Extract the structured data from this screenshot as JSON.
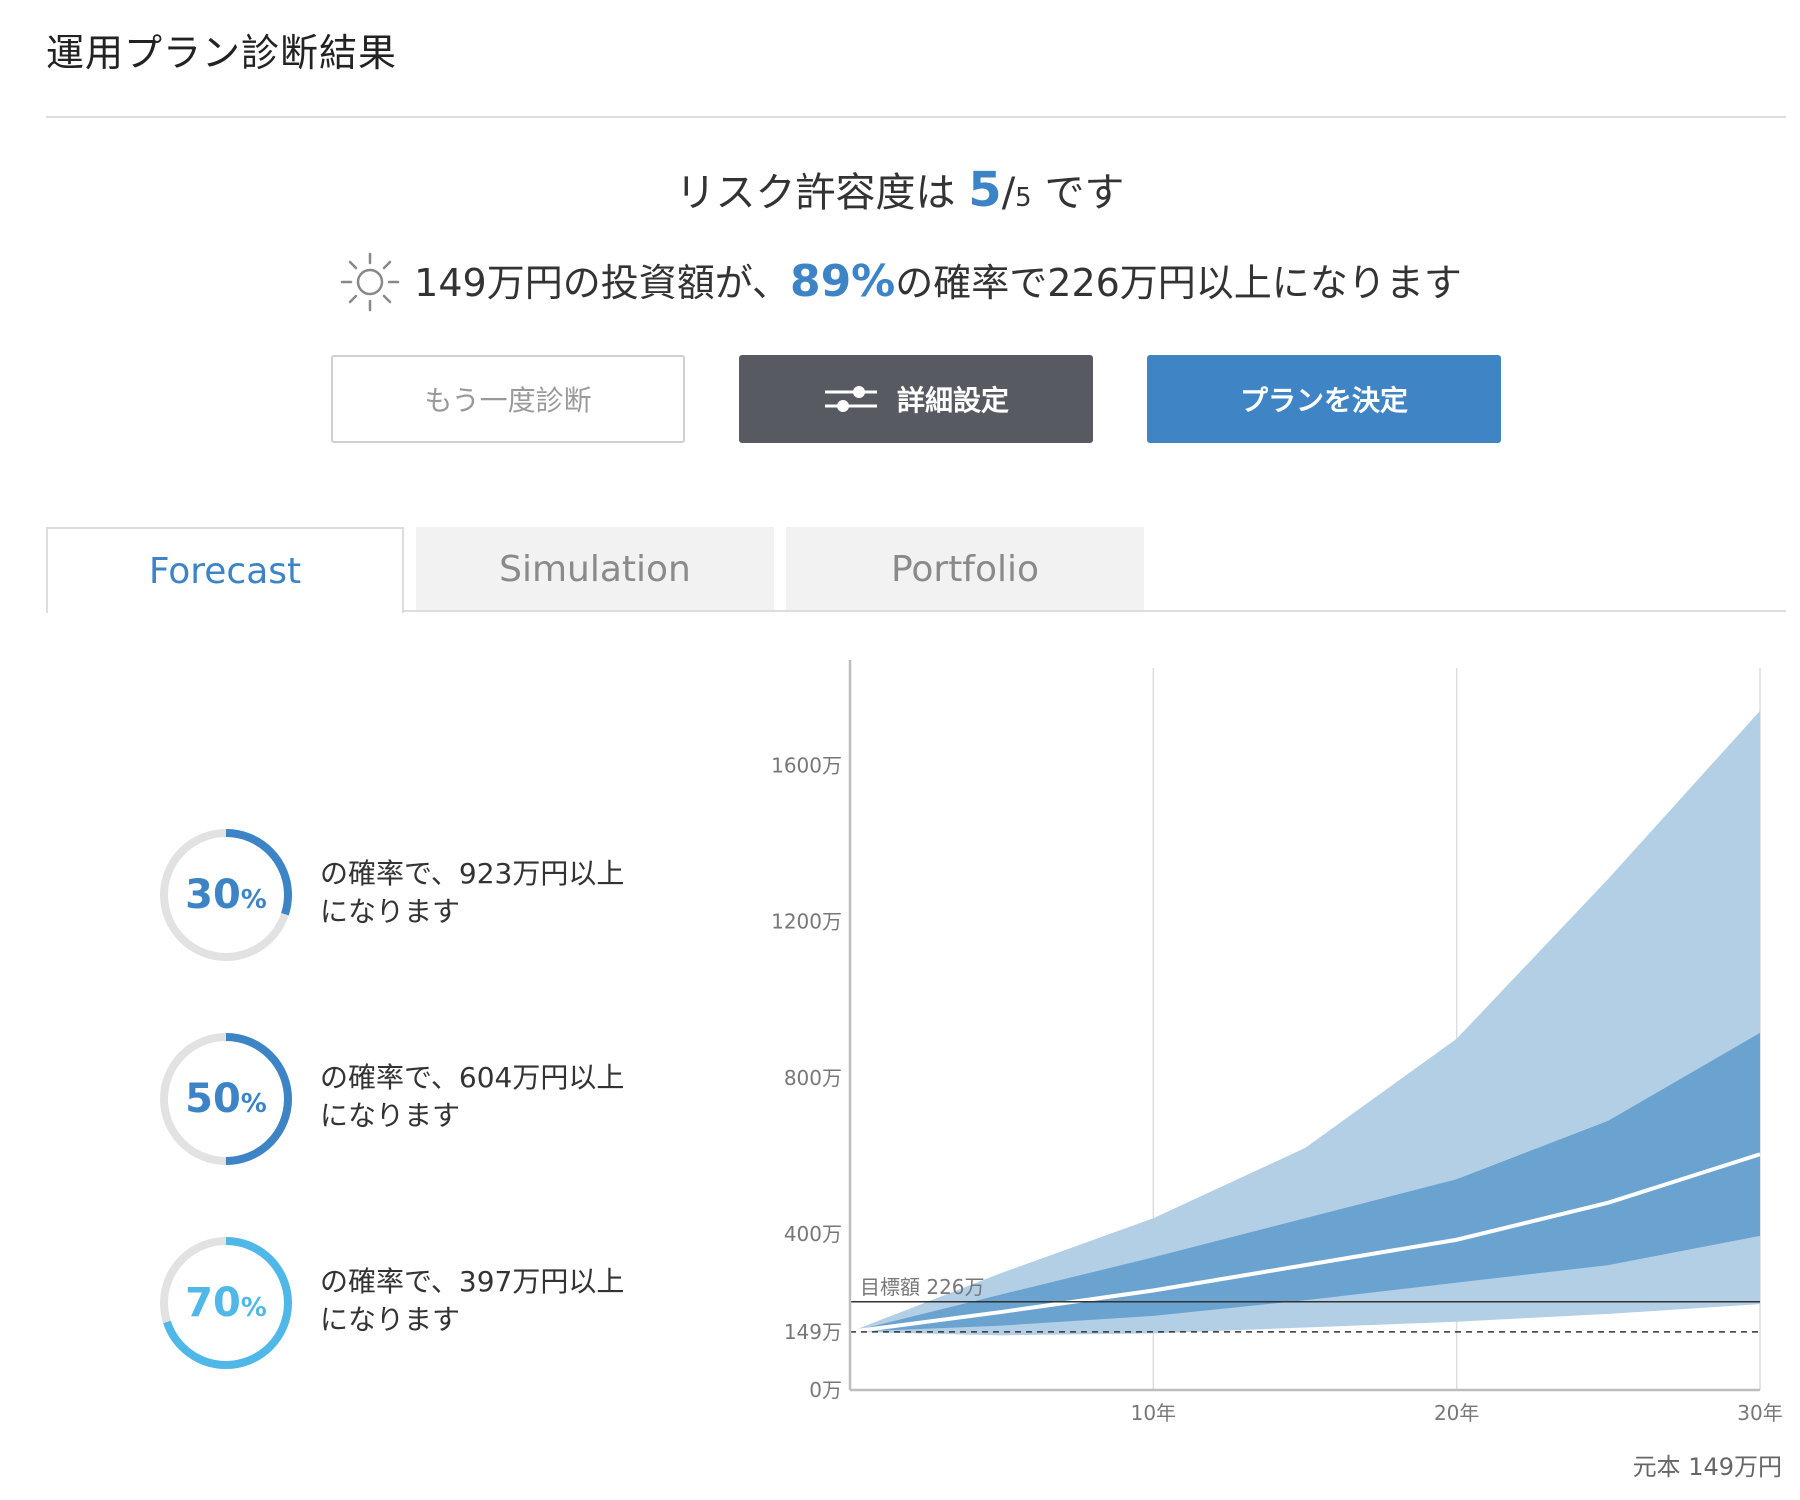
{
  "page_title": "運用プラン診断結果",
  "risk": {
    "prefix": "リスク許容度は",
    "value": "5",
    "slash": "/",
    "max": "5",
    "suffix": "です"
  },
  "probability_summary": {
    "icon": "sun-icon",
    "prefix": "149万円の投資額が、",
    "percent": "89%",
    "suffix": "の確率で226万円以上になります"
  },
  "buttons": {
    "retry": "もう一度診断",
    "detail": "詳細設定",
    "decide": "プランを決定"
  },
  "tabs": [
    "Forecast",
    "Simulation",
    "Portfolio"
  ],
  "active_tab": "Forecast",
  "forecasts": [
    {
      "value": "30",
      "unit": "%",
      "line1": "の確率で、923万円以上",
      "line2": "になります",
      "fraction": 0.3,
      "color": "#3d84c6"
    },
    {
      "value": "50",
      "unit": "%",
      "line1": "の確率で、604万円以上",
      "line2": "になります",
      "fraction": 0.5,
      "color": "#3d84c6"
    },
    {
      "value": "70",
      "unit": "%",
      "line1": "の確率で、397万円以上",
      "line2": "になります",
      "fraction": 0.7,
      "color": "#4fb8e8"
    }
  ],
  "principal_note": "元本 149万円",
  "chart_data": {
    "type": "area",
    "x": [
      0,
      5,
      10,
      15,
      20,
      25,
      30
    ],
    "xticks": [
      {
        "v": 10,
        "label": "10年"
      },
      {
        "v": 20,
        "label": "20年"
      },
      {
        "v": 30,
        "label": "30年"
      }
    ],
    "yticks": [
      {
        "v": 0,
        "label": "0万"
      },
      {
        "v": 149,
        "label": "149万"
      },
      {
        "v": 400,
        "label": "400万"
      },
      {
        "v": 800,
        "label": "800万"
      },
      {
        "v": 1200,
        "label": "1200万"
      },
      {
        "v": 1600,
        "label": "1600万"
      }
    ],
    "xlim": [
      0,
      30
    ],
    "ylim": [
      0,
      1850
    ],
    "outer_band": {
      "upper": [
        149,
        300,
        440,
        620,
        900,
        1310,
        1740
      ],
      "lower": [
        149,
        140,
        145,
        160,
        175,
        195,
        220
      ]
    },
    "inner_band": {
      "upper": [
        149,
        245,
        340,
        440,
        540,
        690,
        915
      ],
      "lower": [
        149,
        165,
        190,
        230,
        275,
        320,
        395
      ]
    },
    "median": [
      149,
      200,
      255,
      320,
      385,
      480,
      604
    ],
    "target": {
      "value": 226,
      "label": "目標額 226万"
    },
    "principal": 149,
    "colors": {
      "outer": "#b3cfe6",
      "inner": "#6aa2d0",
      "median": "#ffffff",
      "target": "#333333",
      "principal": "#333333"
    }
  }
}
